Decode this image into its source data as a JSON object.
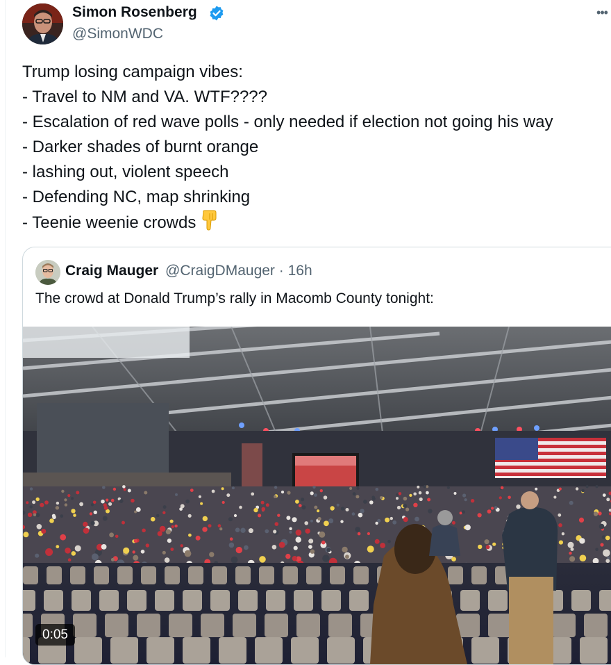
{
  "tweet": {
    "author_name": "Simon Rosenberg",
    "author_handle": "@SimonWDC",
    "more_label": "•••",
    "lines": [
      "Trump losing campaign vibes:",
      "- Travel to NM and VA.  WTF????",
      "- Escalation of red wave polls - only needed if election not going his way",
      "- Darker shades of burnt orange",
      "- lashing out, violent speech",
      "- Defending NC, map shrinking",
      "- Teenie weenie crowds"
    ],
    "trailing_emoji": "backhand-index-pointing-down-icon"
  },
  "quote": {
    "author_name": "Craig Mauger",
    "author_handle": "@CraigDMauger",
    "separator": " · ",
    "time": "16h",
    "text": "The crowd at Donald Trump’s rally in Macomb County tonight:",
    "video_duration": "0:05"
  },
  "colors": {
    "text_primary": "#0f1419",
    "text_secondary": "#536471",
    "verified_badge": "#1d9bf0",
    "border": "#cfd9de"
  }
}
